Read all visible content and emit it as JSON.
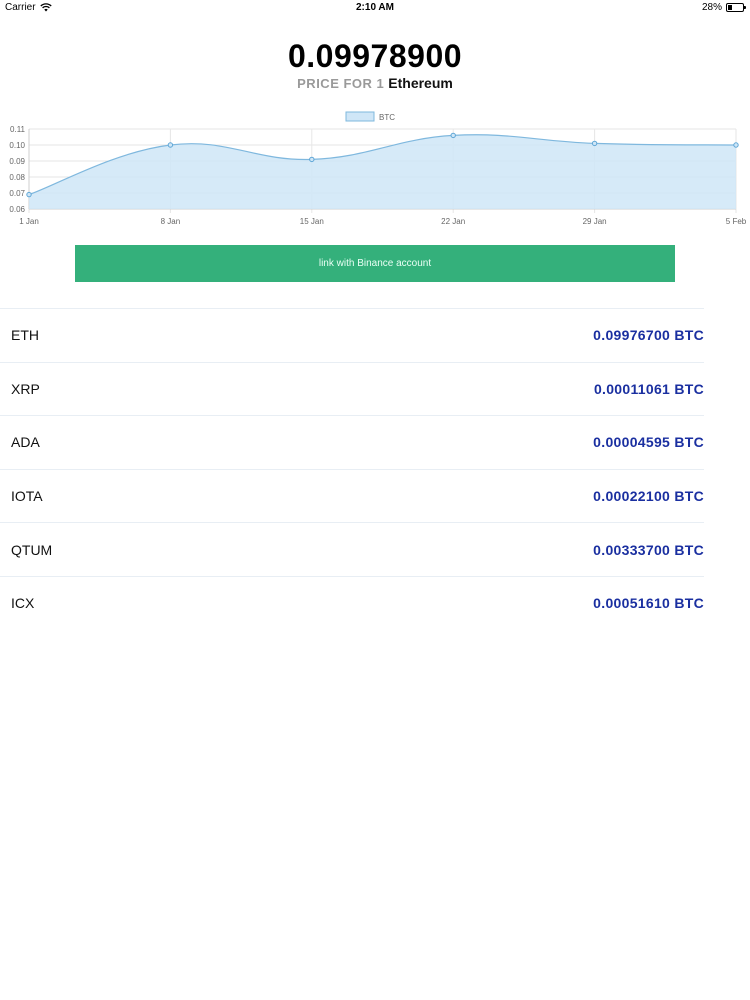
{
  "status_bar": {
    "carrier": "Carrier",
    "time": "2:10 AM",
    "battery": "28%",
    "battery_level": 0.28
  },
  "header": {
    "price": "0.09978900",
    "caption_prefix": "PRICE FOR 1",
    "caption_coin": "Ethereum"
  },
  "chart_data": {
    "type": "area",
    "legend": "BTC",
    "legend_position": "top-center",
    "series_color": "#7fb8de",
    "fill_color": "#cfe6f7",
    "x": [
      "1 Jan",
      "8 Jan",
      "15 Jan",
      "22 Jan",
      "29 Jan",
      "5 Feb"
    ],
    "values": [
      0.069,
      0.1,
      0.091,
      0.106,
      0.101,
      0.1
    ],
    "yticks": [
      "0.11",
      "0.10",
      "0.09",
      "0.08",
      "0.07",
      "0.06"
    ],
    "ylim": [
      0.06,
      0.11
    ],
    "grid": true
  },
  "link_button": {
    "label": "link with Binance account",
    "color": "#34b07b"
  },
  "coins": [
    {
      "symbol": "ETH",
      "price": "0.09976700 BTC"
    },
    {
      "symbol": "XRP",
      "price": "0.00011061 BTC"
    },
    {
      "symbol": "ADA",
      "price": "0.00004595 BTC"
    },
    {
      "symbol": "IOTA",
      "price": "0.00022100 BTC"
    },
    {
      "symbol": "QTUM",
      "price": "0.00333700 BTC"
    },
    {
      "symbol": "ICX",
      "price": "0.00051610 BTC"
    }
  ]
}
